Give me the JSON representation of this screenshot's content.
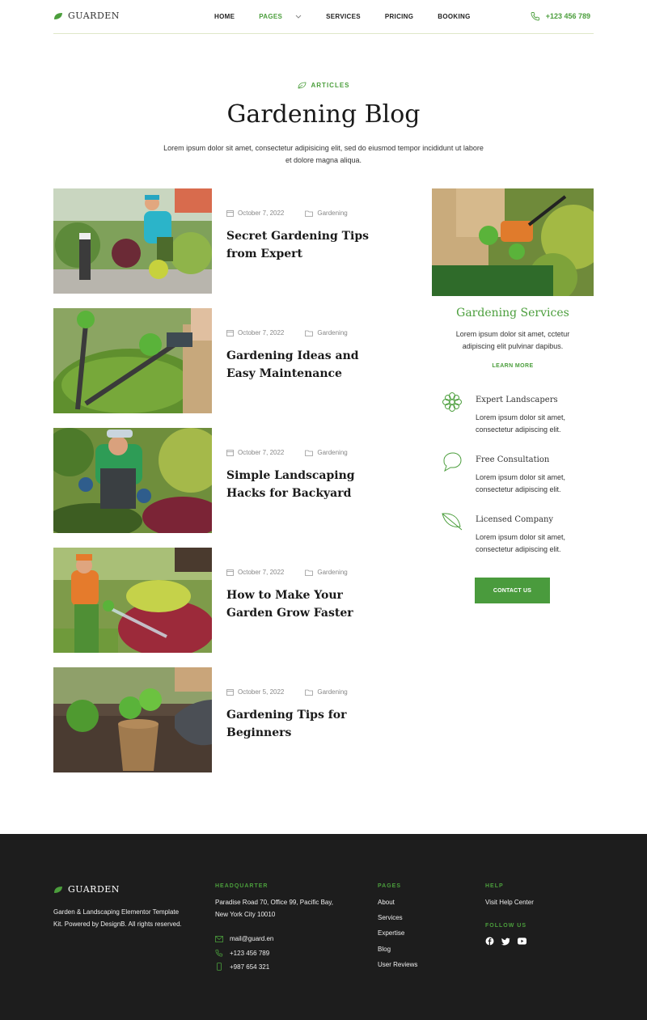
{
  "header": {
    "logo": "GUARDEN",
    "nav": [
      "HOME",
      "PAGES",
      "SERVICES",
      "PRICING",
      "BOOKING"
    ],
    "phone": "+123 456 789"
  },
  "hero": {
    "eyebrow": "ARTICLES",
    "title": "Gardening Blog",
    "intro": "Lorem ipsum dolor sit amet, consectetur adipisicing elit, sed do eiusmod tempor incididunt ut labore et dolore magna aliqua."
  },
  "posts": [
    {
      "date": "October 7, 2022",
      "category": "Gardening",
      "title": "Secret Gardening Tips from Expert"
    },
    {
      "date": "October 7, 2022",
      "category": "Gardening",
      "title": "Gardening Ideas and Easy Maintenance"
    },
    {
      "date": "October 7, 2022",
      "category": "Gardening",
      "title": "Simple Landscaping Hacks for Backyard"
    },
    {
      "date": "October 7, 2022",
      "category": "Gardening",
      "title": "How to Make Your Garden Grow Faster"
    },
    {
      "date": "October 5, 2022",
      "category": "Gardening",
      "title": "Gardening Tips for Beginners"
    }
  ],
  "sidebar": {
    "title": "Gardening Services",
    "text": "Lorem ipsum dolor sit amet, cctetur adipiscing elit pulvinar dapibus.",
    "link": "LEARN MORE",
    "features": [
      {
        "icon": "flower-icon",
        "title": "Expert Landscapers",
        "text": "Lorem ipsum dolor sit amet, consectetur adipiscing elit."
      },
      {
        "icon": "chat-bubble-icon",
        "title": "Free Consultation",
        "text": "Lorem ipsum dolor sit amet, consectetur adipiscing elit."
      },
      {
        "icon": "leaf-icon",
        "title": "Licensed Company",
        "text": "Lorem ipsum dolor sit amet, consectetur adipiscing elit."
      }
    ],
    "button": "CONTACT US"
  },
  "footer": {
    "logo": "GUARDEN",
    "about": "Garden & Landscaping Elementor Template Kit. Powered by DesignB. All rights reserved.",
    "headquarter_heading": "HEADQUARTER",
    "address": "Paradise Road 70, Office 99, Pacific Bay,  New York City 10010",
    "email": "mail@guard.en",
    "phone1": "+123 456 789",
    "phone2": "+987 654 321",
    "pages_heading": "PAGES",
    "pages": [
      "About",
      "Services",
      "Expertise",
      "Blog",
      "User Reviews"
    ],
    "help_heading": "HELP",
    "help_link": "Visit Help Center",
    "follow_heading": "FOLLOW US",
    "socials": [
      "facebook-icon",
      "twitter-icon",
      "youtube-icon"
    ]
  },
  "colors": {
    "accent": "#4b9e3c",
    "footer_bg": "#1d1d1d"
  }
}
